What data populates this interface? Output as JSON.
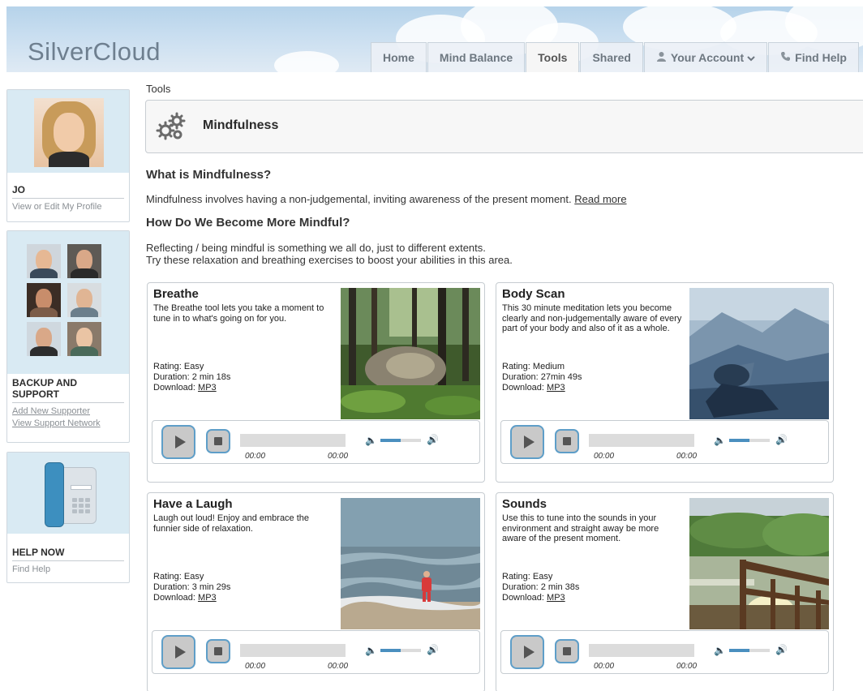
{
  "app": {
    "logo": "SilverCloud"
  },
  "nav": [
    {
      "label": "Home",
      "icon": "",
      "active": false
    },
    {
      "label": "Mind Balance",
      "icon": "",
      "active": false
    },
    {
      "label": "Tools",
      "icon": "",
      "active": true
    },
    {
      "label": "Shared",
      "icon": "",
      "active": false
    },
    {
      "label": "Your Account",
      "icon": "user-icon",
      "active": false,
      "dropdown": true
    },
    {
      "label": "Find Help",
      "icon": "phone-icon",
      "active": false
    }
  ],
  "profile": {
    "name": "JO",
    "edit_link": "View or Edit My Profile"
  },
  "support": {
    "heading": "BACKUP AND SUPPORT",
    "add_link": "Add New Supporter",
    "view_link": "View Support Network"
  },
  "help": {
    "heading": "HELP NOW",
    "link": "Find Help"
  },
  "breadcrumb": "Tools",
  "tool": {
    "title": "Mindfulness",
    "icon": "gears-icon"
  },
  "what": {
    "heading": "What is Mindfulness?",
    "text": "Mindfulness involves having a non-judgemental, inviting awareness of the present moment. ",
    "read_more": "Read more"
  },
  "how": {
    "heading": "How Do We Become More Mindful?",
    "line1": "Reflecting / being mindful is something we all do, just to different extents.",
    "line2": "Try these relaxation and breathing exercises to boost your abilities in this area."
  },
  "labels": {
    "rating": "Rating: ",
    "duration": "Duration: ",
    "download": "Download: "
  },
  "tiles": [
    {
      "title": "Breathe",
      "description": "The Breathe tool lets you take a moment to tune in to what's going on for you.",
      "rating": "Easy",
      "duration": "2 min 18s",
      "download": "MP3",
      "time_start": "00:00",
      "time_end": "00:00",
      "volume": 0.5
    },
    {
      "title": "Body Scan",
      "description": "This 30 minute meditation lets you become clearly and non-judgementally aware of every part of your body and also of it as a whole.",
      "rating": "Medium",
      "duration": "27min 49s",
      "download": "MP3",
      "time_start": "00:00",
      "time_end": "00:00",
      "volume": 0.5
    },
    {
      "title": "Have a Laugh",
      "description": "Laugh out loud! Enjoy and embrace the funnier side of relaxation.",
      "rating": "Easy",
      "duration": "3 min 29s",
      "download": "MP3",
      "time_start": "00:00",
      "time_end": "00:00",
      "volume": 0.5
    },
    {
      "title": "Sounds",
      "description": "Use this to tune into the sounds in your environment and straight away be more aware of the present moment.",
      "rating": "Easy",
      "duration": "2 min 38s",
      "download": "MP3",
      "time_start": "00:00",
      "time_end": "00:00",
      "volume": 0.5
    }
  ],
  "colors": {
    "accent": "#4a8fbf",
    "sidebar_bg": "#d9eaf3",
    "header_sky": "#b6d3ea"
  }
}
